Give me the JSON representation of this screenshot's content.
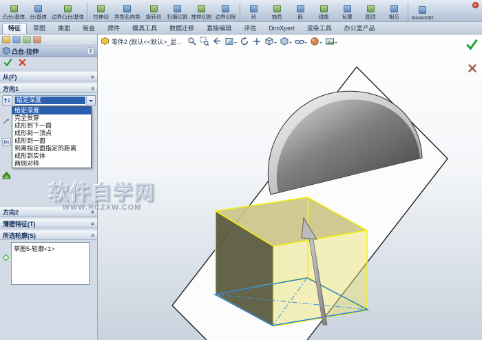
{
  "ribbon": {
    "buttons": [
      "凸台/基体",
      "台/基体",
      "边界凸台/基体",
      "拉伸切",
      "异型孔向导",
      "旋转切",
      "扫描切割",
      "放样切割",
      "边界切除",
      "列",
      "抽壳",
      "筋",
      "镜像",
      "包覆",
      "圆顶",
      "相交",
      "Instant3D"
    ]
  },
  "tabbar": {
    "tabs": [
      "特征",
      "草图",
      "曲面",
      "钣金",
      "焊件",
      "模具工具",
      "数据迁移",
      "直接编辑",
      "评估",
      "DimXpert",
      "渲染工具",
      "办公室产品"
    ],
    "active_tab": "特征"
  },
  "property_manager": {
    "title": "凸台-拉伸",
    "sections": {
      "from": "从(F)",
      "direction1": "方向1",
      "direction2": "方向2",
      "thin_feature": "薄壁特征(T)",
      "selected_contours": "所选轮廓(S)"
    },
    "end_condition": {
      "selected": "给定深度",
      "options": [
        "给定深度",
        "完全贯穿",
        "成形到下一面",
        "成形到一顶点",
        "成形到一面",
        "到离指定面指定的距离",
        "成形到实体",
        "两侧对称"
      ]
    },
    "depth_label": "D1",
    "contours": [
      "草图5-轮廓<1>"
    ]
  },
  "viewport": {
    "document_title": "零件2 (默认<<默认>_显..."
  },
  "watermark": {
    "line1": "软件自学网",
    "line2": "WWW.RCZXW.COM"
  },
  "colors": {
    "selection_highlight": "#2a5fb0",
    "preview_yellow": "#f6f200",
    "sketch_blue": "#1e7fe0",
    "confirm_green": "#1d9e33",
    "cancel_red": "#cc2a10"
  }
}
